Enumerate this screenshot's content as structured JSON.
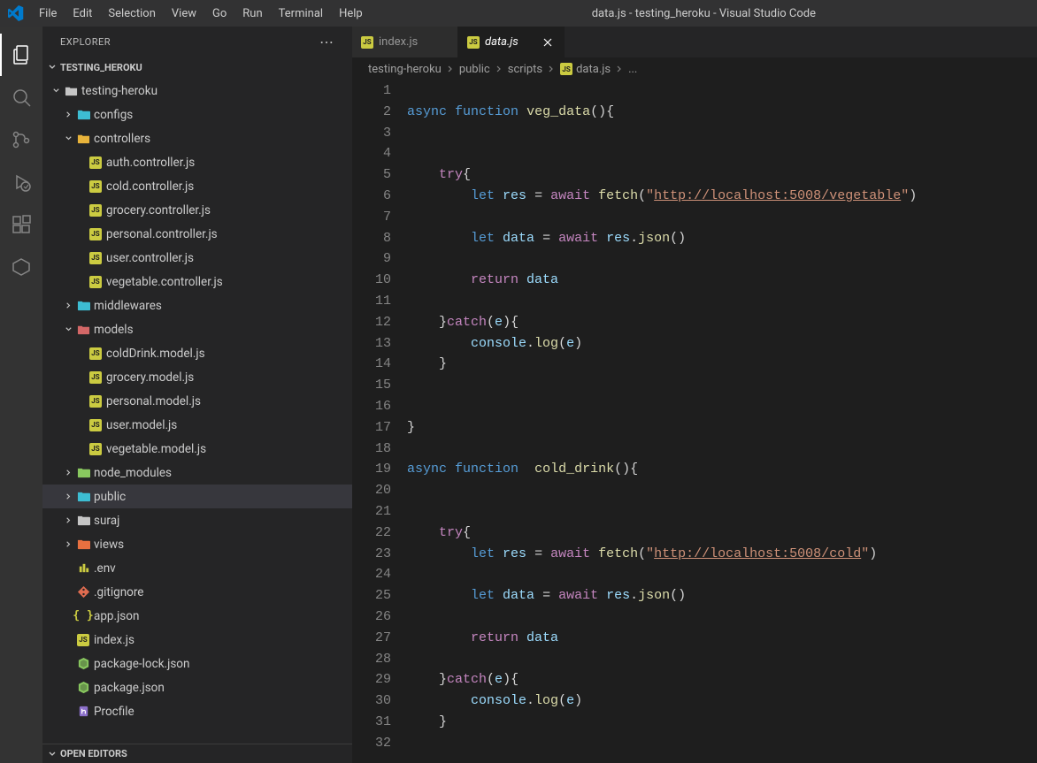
{
  "window_title": "data.js - testing_heroku - Visual Studio Code",
  "menu": [
    "File",
    "Edit",
    "Selection",
    "View",
    "Go",
    "Run",
    "Terminal",
    "Help"
  ],
  "sidebar": {
    "title": "EXPLORER",
    "project": "TESTING_HEROKU",
    "tree": [
      {
        "d": 0,
        "t": "folder",
        "open": true,
        "label": "testing-heroku",
        "color": "#c5c5c5"
      },
      {
        "d": 1,
        "t": "folder",
        "open": false,
        "label": "configs",
        "color": "#3dbdd3"
      },
      {
        "d": 1,
        "t": "folder",
        "open": true,
        "label": "controllers",
        "color": "#e8b33b"
      },
      {
        "d": 2,
        "t": "js",
        "label": "auth.controller.js"
      },
      {
        "d": 2,
        "t": "js",
        "label": "cold.controller.js"
      },
      {
        "d": 2,
        "t": "js",
        "label": "grocery.controller.js"
      },
      {
        "d": 2,
        "t": "js",
        "label": "personal.controller.js"
      },
      {
        "d": 2,
        "t": "js",
        "label": "user.controller.js"
      },
      {
        "d": 2,
        "t": "js",
        "label": "vegetable.controller.js"
      },
      {
        "d": 1,
        "t": "folder",
        "open": false,
        "label": "middlewares",
        "color": "#3dbdd3"
      },
      {
        "d": 1,
        "t": "folder",
        "open": true,
        "label": "models",
        "color": "#d36767"
      },
      {
        "d": 2,
        "t": "js",
        "label": "coldDrink.model.js"
      },
      {
        "d": 2,
        "t": "js",
        "label": "grocery.model.js"
      },
      {
        "d": 2,
        "t": "js",
        "label": "personal.model.js"
      },
      {
        "d": 2,
        "t": "js",
        "label": "user.model.js"
      },
      {
        "d": 2,
        "t": "js",
        "label": "vegetable.model.js"
      },
      {
        "d": 1,
        "t": "folder",
        "open": false,
        "label": "node_modules",
        "color": "#89c85f"
      },
      {
        "d": 1,
        "t": "folder",
        "open": false,
        "label": "public",
        "color": "#3dbdd3",
        "selected": true
      },
      {
        "d": 1,
        "t": "folder",
        "open": false,
        "label": "suraj",
        "color": "#c5c5c5"
      },
      {
        "d": 1,
        "t": "folder",
        "open": false,
        "label": "views",
        "color": "#e87040"
      },
      {
        "d": 1,
        "t": "env",
        "label": ".env"
      },
      {
        "d": 1,
        "t": "git",
        "label": ".gitignore"
      },
      {
        "d": 1,
        "t": "json",
        "label": "app.json"
      },
      {
        "d": 1,
        "t": "js",
        "label": "index.js"
      },
      {
        "d": 1,
        "t": "npm",
        "label": "package-lock.json"
      },
      {
        "d": 1,
        "t": "npm",
        "label": "package.json"
      },
      {
        "d": 1,
        "t": "heroku",
        "label": "Procfile"
      }
    ],
    "footer": "OPEN EDITORS"
  },
  "tabs": [
    {
      "label": "index.js",
      "active": false
    },
    {
      "label": "data.js",
      "active": true,
      "italic": true
    }
  ],
  "breadcrumb": [
    "testing-heroku",
    "public",
    "scripts",
    "data.js",
    "..."
  ],
  "code": {
    "lines": 32,
    "content": [
      "",
      [
        [
          "k1",
          "async"
        ],
        [
          "pl",
          " "
        ],
        [
          "kw-fn",
          "function"
        ],
        [
          "pl",
          " "
        ],
        [
          "fn",
          "veg_data"
        ],
        [
          "pl",
          "(){"
        ]
      ],
      "",
      "",
      [
        [
          "pl",
          "    "
        ],
        [
          "k2",
          "try"
        ],
        [
          "pl",
          "{"
        ]
      ],
      [
        [
          "pl",
          "        "
        ],
        [
          "k1",
          "let"
        ],
        [
          "pl",
          " "
        ],
        [
          "vr",
          "res"
        ],
        [
          "pl",
          " = "
        ],
        [
          "k2",
          "await"
        ],
        [
          "pl",
          " "
        ],
        [
          "fn",
          "fetch"
        ],
        [
          "pl",
          "("
        ],
        [
          "st",
          "\""
        ],
        [
          "url",
          "http://localhost:5008/vegetable"
        ],
        [
          "st",
          "\""
        ],
        [
          "pl",
          ")"
        ]
      ],
      "",
      [
        [
          "pl",
          "        "
        ],
        [
          "k1",
          "let"
        ],
        [
          "pl",
          " "
        ],
        [
          "vr",
          "data"
        ],
        [
          "pl",
          " = "
        ],
        [
          "k2",
          "await"
        ],
        [
          "pl",
          " "
        ],
        [
          "vr",
          "res"
        ],
        [
          "pl",
          "."
        ],
        [
          "fn",
          "json"
        ],
        [
          "pl",
          "()"
        ]
      ],
      "",
      [
        [
          "pl",
          "        "
        ],
        [
          "k2",
          "return"
        ],
        [
          "pl",
          " "
        ],
        [
          "vr",
          "data"
        ]
      ],
      "",
      [
        [
          "pl",
          "    }"
        ],
        [
          "k2",
          "catch"
        ],
        [
          "pl",
          "("
        ],
        [
          "vr",
          "e"
        ],
        [
          "pl",
          "){"
        ]
      ],
      [
        [
          "pl",
          "        "
        ],
        [
          "vr",
          "console"
        ],
        [
          "pl",
          "."
        ],
        [
          "fn",
          "log"
        ],
        [
          "pl",
          "("
        ],
        [
          "vr",
          "e"
        ],
        [
          "pl",
          ")"
        ]
      ],
      [
        [
          "pl",
          "    }"
        ]
      ],
      "",
      "",
      [
        [
          "pl",
          "}"
        ]
      ],
      "",
      [
        [
          "k1",
          "async"
        ],
        [
          "pl",
          " "
        ],
        [
          "kw-fn",
          "function"
        ],
        [
          "pl",
          "  "
        ],
        [
          "fn",
          "cold_drink"
        ],
        [
          "pl",
          "(){"
        ]
      ],
      "",
      "",
      [
        [
          "pl",
          "    "
        ],
        [
          "k2",
          "try"
        ],
        [
          "pl",
          "{"
        ]
      ],
      [
        [
          "pl",
          "        "
        ],
        [
          "k1",
          "let"
        ],
        [
          "pl",
          " "
        ],
        [
          "vr",
          "res"
        ],
        [
          "pl",
          " = "
        ],
        [
          "k2",
          "await"
        ],
        [
          "pl",
          " "
        ],
        [
          "fn",
          "fetch"
        ],
        [
          "pl",
          "("
        ],
        [
          "st",
          "\""
        ],
        [
          "url",
          "http://localhost:5008/cold"
        ],
        [
          "st",
          "\""
        ],
        [
          "pl",
          ")"
        ]
      ],
      "",
      [
        [
          "pl",
          "        "
        ],
        [
          "k1",
          "let"
        ],
        [
          "pl",
          " "
        ],
        [
          "vr",
          "data"
        ],
        [
          "pl",
          " = "
        ],
        [
          "k2",
          "await"
        ],
        [
          "pl",
          " "
        ],
        [
          "vr",
          "res"
        ],
        [
          "pl",
          "."
        ],
        [
          "fn",
          "json"
        ],
        [
          "pl",
          "()"
        ]
      ],
      "",
      [
        [
          "pl",
          "        "
        ],
        [
          "k2",
          "return"
        ],
        [
          "pl",
          " "
        ],
        [
          "vr",
          "data"
        ]
      ],
      "",
      [
        [
          "pl",
          "    }"
        ],
        [
          "k2",
          "catch"
        ],
        [
          "pl",
          "("
        ],
        [
          "vr",
          "e"
        ],
        [
          "pl",
          "){"
        ]
      ],
      [
        [
          "pl",
          "        "
        ],
        [
          "vr",
          "console"
        ],
        [
          "pl",
          "."
        ],
        [
          "fn",
          "log"
        ],
        [
          "pl",
          "("
        ],
        [
          "vr",
          "e"
        ],
        [
          "pl",
          ")"
        ]
      ],
      [
        [
          "pl",
          "    }"
        ]
      ],
      ""
    ]
  }
}
